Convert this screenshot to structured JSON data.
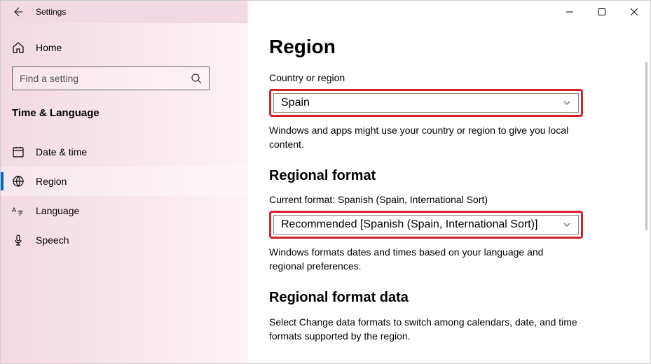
{
  "titlebar": {
    "title": "Settings"
  },
  "sidebar": {
    "home_label": "Home",
    "search_placeholder": "Find a setting",
    "category": "Time & Language",
    "items": [
      {
        "label": "Date & time"
      },
      {
        "label": "Region"
      },
      {
        "label": "Language"
      },
      {
        "label": "Speech"
      }
    ]
  },
  "content": {
    "page_title": "Region",
    "country_label": "Country or region",
    "country_value": "Spain",
    "country_desc": "Windows and apps might use your country or region to give you local content.",
    "format_title": "Regional format",
    "format_current": "Current format: Spanish (Spain, International Sort)",
    "format_value": "Recommended [Spanish (Spain, International Sort)]",
    "format_desc": "Windows formats dates and times based on your language and regional preferences.",
    "data_title": "Regional format data",
    "data_desc": "Select Change data formats to switch among calendars, date, and time formats supported by the region."
  }
}
